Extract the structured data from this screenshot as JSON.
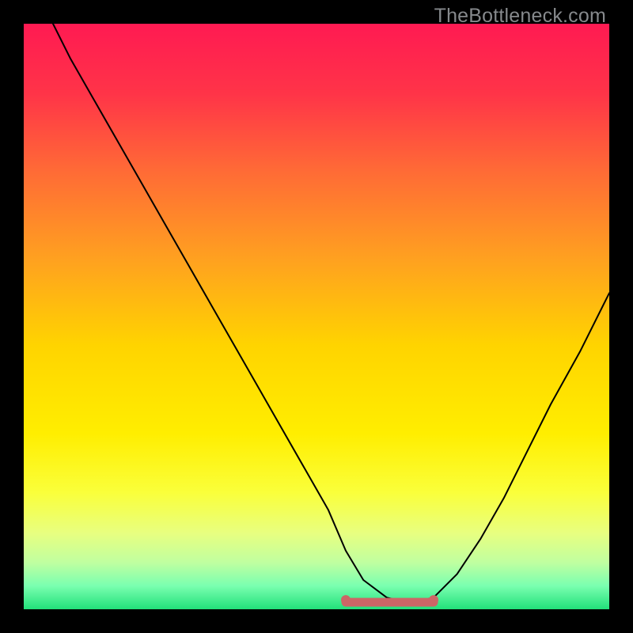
{
  "watermark": "TheBottleneck.com",
  "colors": {
    "frame": "#000000",
    "gradient_stops": [
      {
        "offset": 0.0,
        "color": "#ff1a52"
      },
      {
        "offset": 0.12,
        "color": "#ff3448"
      },
      {
        "offset": 0.25,
        "color": "#ff6a36"
      },
      {
        "offset": 0.4,
        "color": "#ffa020"
      },
      {
        "offset": 0.55,
        "color": "#ffd400"
      },
      {
        "offset": 0.7,
        "color": "#ffee00"
      },
      {
        "offset": 0.8,
        "color": "#faff3a"
      },
      {
        "offset": 0.87,
        "color": "#e8ff80"
      },
      {
        "offset": 0.92,
        "color": "#c0ffa0"
      },
      {
        "offset": 0.96,
        "color": "#7affb0"
      },
      {
        "offset": 1.0,
        "color": "#22e07a"
      }
    ],
    "curve": "#000000",
    "optimal_segment": "#cc6666"
  },
  "chart_data": {
    "type": "line",
    "title": "",
    "xlabel": "",
    "ylabel": "",
    "xlim": [
      0,
      100
    ],
    "ylim": [
      0,
      100
    ],
    "series": [
      {
        "name": "bottleneck-curve",
        "x": [
          5,
          8,
          12,
          16,
          20,
          24,
          28,
          32,
          36,
          40,
          44,
          48,
          52,
          55,
          58,
          62,
          66,
          70,
          74,
          78,
          82,
          86,
          90,
          95,
          100
        ],
        "values": [
          100,
          94,
          87,
          80,
          73,
          66,
          59,
          52,
          45,
          38,
          31,
          24,
          17,
          10,
          5,
          2,
          1,
          2,
          6,
          12,
          19,
          27,
          35,
          44,
          54
        ]
      }
    ],
    "optimal_segment": {
      "x_start": 55,
      "x_end": 70,
      "y": 1.2
    },
    "annotations": []
  }
}
